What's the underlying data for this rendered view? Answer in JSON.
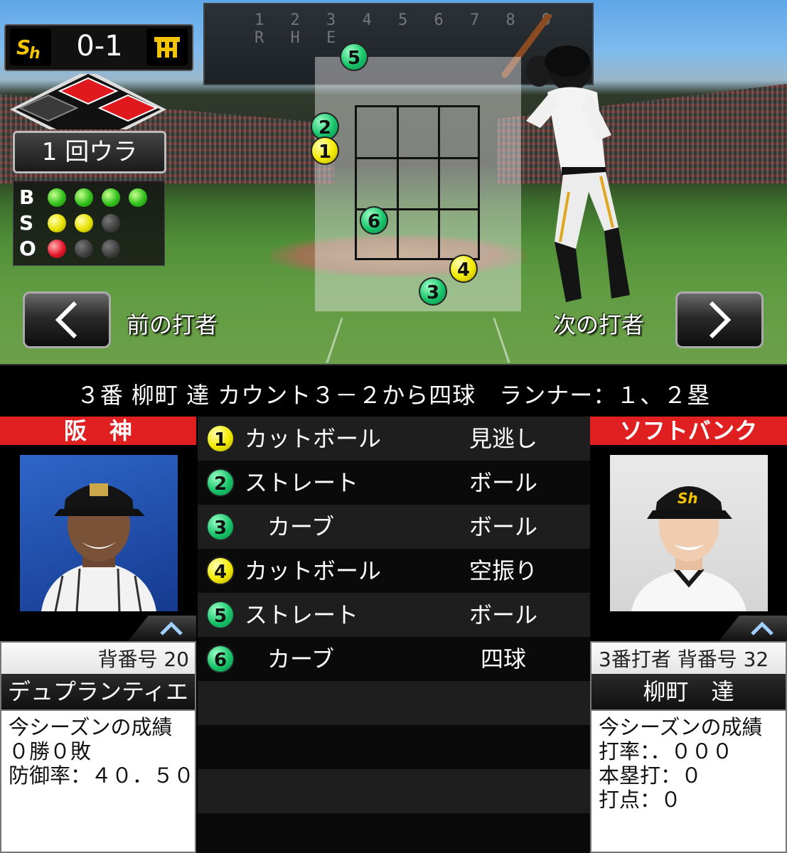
{
  "scoreboard": {
    "digits": "1 2 3 4 5 6 7 8 9 R H E",
    "home_logo": "SH",
    "away_logo": "HT",
    "score": "0-1"
  },
  "inning": "1 回ウラ",
  "count": {
    "b_label": "B",
    "s_label": "S",
    "o_label": "O",
    "balls": 4,
    "strikes": 2,
    "outs": 1
  },
  "nav": {
    "prev_label": "前の打者",
    "next_label": "次の打者"
  },
  "atbat_summary": "３番 柳町 達 カウント３－２から四球　ランナー：１、２塁",
  "left_team": "阪　神",
  "right_team": "ソフトバンク",
  "pitches": [
    {
      "num": "1",
      "color": "#f2ea00",
      "type": "カットボール",
      "result": "見逃し"
    },
    {
      "num": "2",
      "color": "#18c46a",
      "type": "ストレート",
      "result": "ボール"
    },
    {
      "num": "3",
      "color": "#18c46a",
      "type": "　カーブ",
      "result": "ボール"
    },
    {
      "num": "4",
      "color": "#f2ea00",
      "type": "カットボール",
      "result": "空振り"
    },
    {
      "num": "5",
      "color": "#18c46a",
      "type": "ストレート",
      "result": "ボール"
    },
    {
      "num": "6",
      "color": "#18c46a",
      "type": "　カーブ",
      "result": "四球"
    }
  ],
  "pitcher": {
    "number_label": "背番号 20",
    "name": "デュプランティエ",
    "stats": "今シーズンの成績\n０勝０敗\n防御率：４０．５０"
  },
  "batter": {
    "number_label": "3番打者 背番号 32",
    "name": "柳町　達",
    "stats": "今シーズンの成績\n打率：．０００\n本塁打：０\n打点：０"
  }
}
